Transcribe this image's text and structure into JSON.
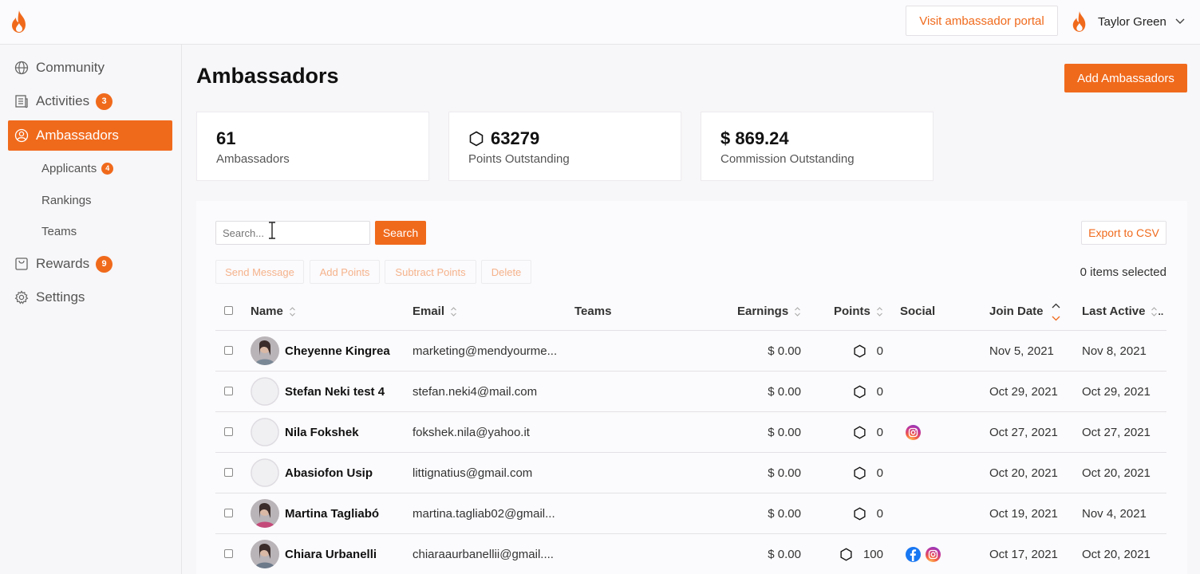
{
  "header": {
    "portal_button": "Visit ambassador portal",
    "user_name": "Taylor Green"
  },
  "sidebar": {
    "items": [
      {
        "label": "Community",
        "icon": "globe-icon"
      },
      {
        "label": "Activities",
        "icon": "newspaper-icon",
        "badge": "3"
      },
      {
        "label": "Ambassadors",
        "icon": "user-circle-icon",
        "active": true
      },
      {
        "label": "Rewards",
        "icon": "shopping-bag-icon",
        "badge": "9"
      },
      {
        "label": "Settings",
        "icon": "gear-icon"
      }
    ],
    "subitems": [
      {
        "label": "Applicants",
        "badge": "4"
      },
      {
        "label": "Rankings"
      },
      {
        "label": "Teams"
      }
    ]
  },
  "main": {
    "title": "Ambassadors",
    "add_button": "Add Ambassadors",
    "stats": [
      {
        "value": "61",
        "label": "Ambassadors"
      },
      {
        "value": "63279",
        "label": "Points Outstanding",
        "icon": "hexagon-icon"
      },
      {
        "value": "$ 869.24",
        "label": "Commission Outstanding"
      }
    ],
    "search_placeholder": "Search...",
    "search_button": "Search",
    "export_button": "Export to CSV",
    "actions": [
      "Send Message",
      "Add Points",
      "Subtract Points",
      "Delete"
    ],
    "selected_text": "0 items selected"
  },
  "table": {
    "columns": [
      "Name",
      "Email",
      "Teams",
      "Earnings",
      "Points",
      "Social",
      "Join Date",
      "Last Active"
    ],
    "rows": [
      {
        "name": "Cheyenne Kingrea",
        "email": "marketing@mendyourme...",
        "earnings": "$ 0.00",
        "points": "0",
        "social": [],
        "join": "Nov 5, 2021",
        "last": "Nov 8, 2021",
        "avatar": "photo"
      },
      {
        "name": "Stefan Neki test 4",
        "email": "stefan.neki4@mail.com",
        "earnings": "$ 0.00",
        "points": "0",
        "social": [],
        "join": "Oct 29, 2021",
        "last": "Oct 29, 2021",
        "avatar": "placeholder"
      },
      {
        "name": "Nila Fokshek",
        "email": "fokshek.nila@yahoo.it",
        "earnings": "$ 0.00",
        "points": "0",
        "social": [
          "instagram"
        ],
        "join": "Oct 27, 2021",
        "last": "Oct 27, 2021",
        "avatar": "placeholder"
      },
      {
        "name": "Abasiofon Usip",
        "email": "littignatius@gmail.com",
        "earnings": "$ 0.00",
        "points": "0",
        "social": [],
        "join": "Oct 20, 2021",
        "last": "Oct 20, 2021",
        "avatar": "placeholder"
      },
      {
        "name": "Martina Tagliabó",
        "email": "martina.tagliab02@gmail...",
        "earnings": "$ 0.00",
        "points": "0",
        "social": [],
        "join": "Oct 19, 2021",
        "last": "Nov 4, 2021",
        "avatar": "photo"
      },
      {
        "name": "Chiara Urbanelli",
        "email": "chiaraaurbanellii@gmail....",
        "earnings": "$ 0.00",
        "points": "100",
        "social": [
          "facebook",
          "instagram"
        ],
        "join": "Oct 17, 2021",
        "last": "Oct 20, 2021",
        "avatar": "photo"
      }
    ]
  },
  "colors": {
    "accent": "#f06a1c"
  }
}
